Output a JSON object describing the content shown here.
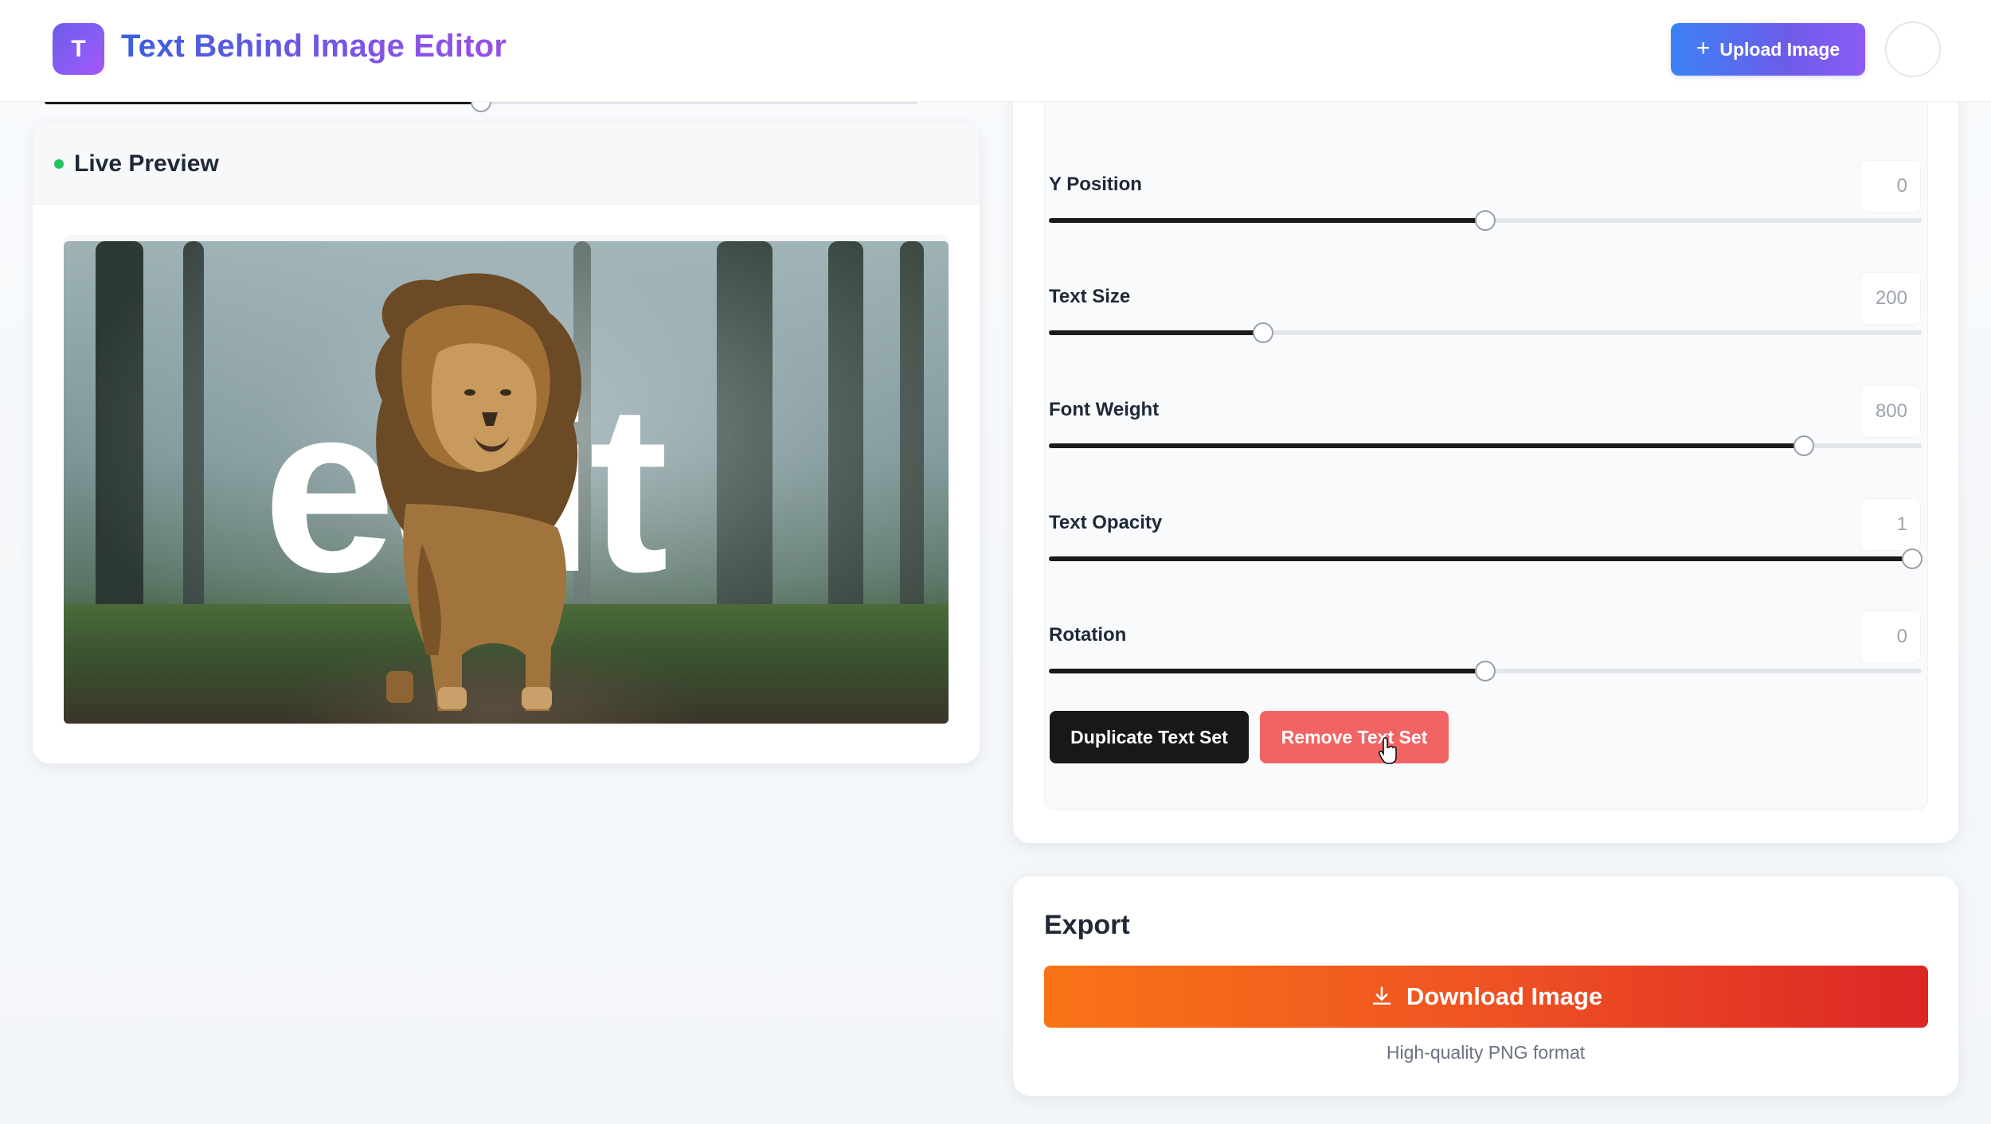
{
  "header": {
    "logo_letter": "T",
    "title": "Text Behind Image Editor",
    "upload_label": "Upload Image",
    "upload_icon": "plus-icon"
  },
  "preview": {
    "title": "Live Preview",
    "background_text": "edit",
    "status_color": "#22c55e"
  },
  "controls": {
    "sliders": [
      {
        "label": "Y Position",
        "value": "0",
        "fraction": 0.5
      },
      {
        "label": "Text Size",
        "value": "200",
        "fraction": 0.245
      },
      {
        "label": "Font Weight",
        "value": "800",
        "fraction": 0.865
      },
      {
        "label": "Text Opacity",
        "value": "1",
        "fraction": 0.989
      },
      {
        "label": "Rotation",
        "value": "0",
        "fraction": 0.5
      }
    ],
    "top_slider_fraction": 0.5,
    "duplicate_label": "Duplicate Text Set",
    "remove_label": "Remove Text Set"
  },
  "export": {
    "title": "Export",
    "download_label": "Download Image",
    "download_icon": "download-icon",
    "note": "High-quality PNG format"
  },
  "colors": {
    "accent_blue": "#3b82f6",
    "accent_purple": "#8b5cf6",
    "danger": "#f26464",
    "export_orange": "#f97316",
    "export_red": "#dc2626"
  }
}
